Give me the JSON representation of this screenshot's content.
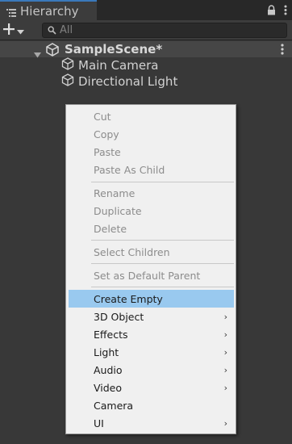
{
  "window": {
    "tab_title": "Hierarchy"
  },
  "toolbar": {
    "add_label": "+",
    "search_placeholder": "All"
  },
  "tree": {
    "scene_name": "SampleScene*",
    "items": [
      {
        "label": "Main Camera"
      },
      {
        "label": "Directional Light"
      }
    ]
  },
  "context_menu": {
    "items": [
      {
        "label": "Cut",
        "enabled": false
      },
      {
        "label": "Copy",
        "enabled": false
      },
      {
        "label": "Paste",
        "enabled": false
      },
      {
        "label": "Paste As Child",
        "enabled": false
      },
      {
        "label": "Rename",
        "enabled": false
      },
      {
        "label": "Duplicate",
        "enabled": false
      },
      {
        "label": "Delete",
        "enabled": false
      },
      {
        "label": "Select Children",
        "enabled": false
      },
      {
        "label": "Set as Default Parent",
        "enabled": false
      },
      {
        "label": "Create Empty",
        "enabled": true,
        "highlighted": true
      },
      {
        "label": "3D Object",
        "enabled": true,
        "submenu": true
      },
      {
        "label": "Effects",
        "enabled": true,
        "submenu": true
      },
      {
        "label": "Light",
        "enabled": true,
        "submenu": true
      },
      {
        "label": "Audio",
        "enabled": true,
        "submenu": true
      },
      {
        "label": "Video",
        "enabled": true,
        "submenu": true
      },
      {
        "label": "Camera",
        "enabled": true
      },
      {
        "label": "UI",
        "enabled": true,
        "submenu": true
      }
    ],
    "submenu_arrow": "›"
  },
  "colors": {
    "accent": "#3a79bb",
    "highlight": "#99c9ef",
    "panel_bg": "#383838",
    "menu_bg": "#f0f0f0"
  }
}
